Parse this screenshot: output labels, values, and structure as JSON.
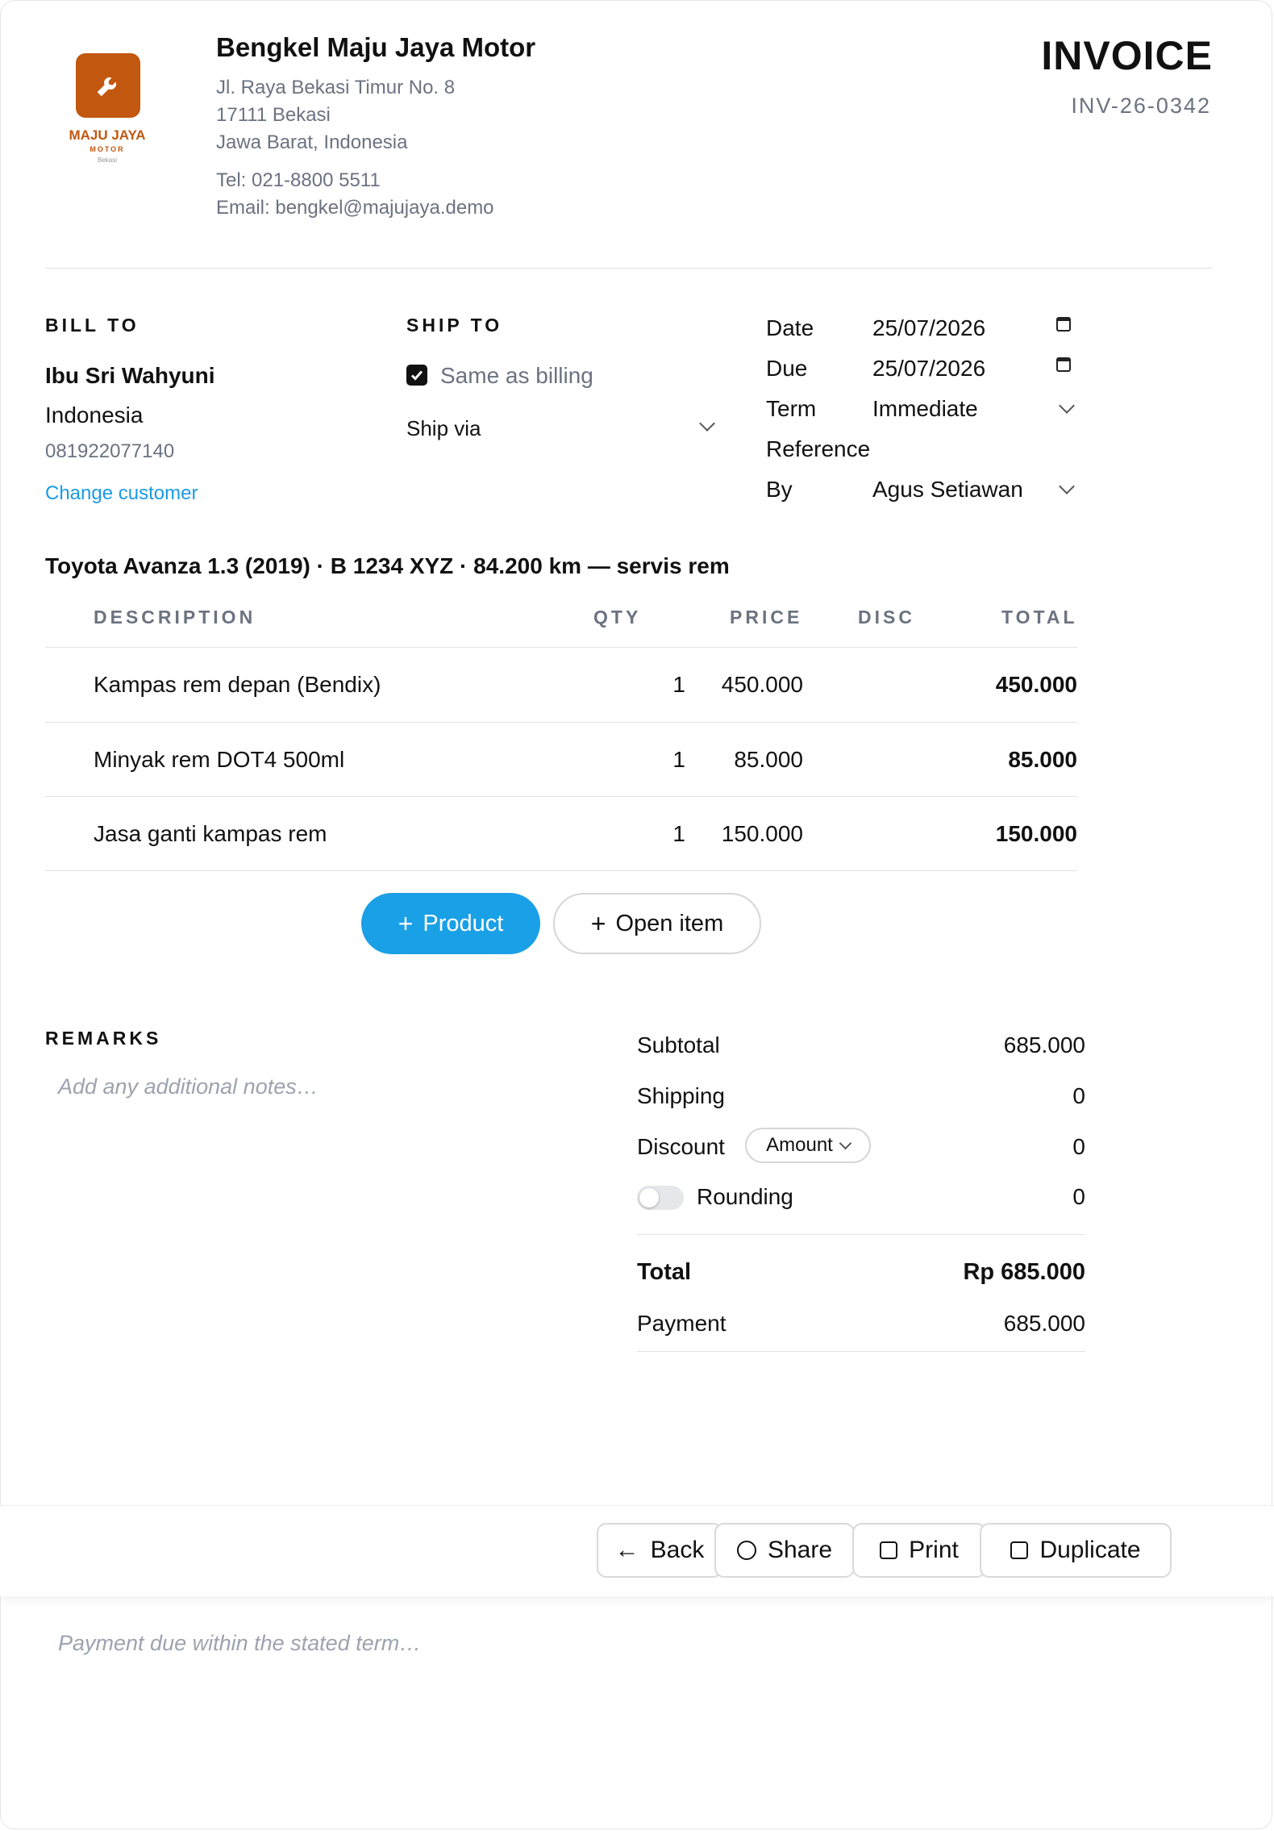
{
  "company": {
    "logo_name": "MAJU JAYA",
    "logo_sub": "MOTOR",
    "logo_city": "Bekasi",
    "name": "Bengkel Maju Jaya Motor",
    "address1": "Jl. Raya Bekasi Timur No. 8",
    "address2": "17111 Bekasi",
    "address3": "Jawa Barat, Indonesia",
    "tel": "Tel: 021-8800 5511",
    "email": "Email: bengkel@majujaya.demo",
    "brand_color": "#c2570f"
  },
  "invoice": {
    "title": "INVOICE",
    "number": "INV-26-0342"
  },
  "bill_to": {
    "label": "BILL TO",
    "name": "Ibu Sri Wahyuni",
    "country": "Indonesia",
    "phone": "081922077140",
    "change_link": "Change customer"
  },
  "ship_to": {
    "label": "SHIP TO",
    "same_as_billing": "Same as billing",
    "same_checked": true,
    "ship_via": "Ship via"
  },
  "meta": {
    "date_label": "Date",
    "date_value": "25/07/2026",
    "due_label": "Due",
    "due_value": "25/07/2026",
    "term_label": "Term",
    "term_value": "Immediate",
    "reference_label": "Reference",
    "reference_value": "",
    "by_label": "By",
    "by_value": "Agus Setiawan"
  },
  "vehicle_line": "Toyota Avanza 1.3 (2019) · B 1234 XYZ · 84.200 km — servis rem",
  "table": {
    "headers": {
      "description": "DESCRIPTION",
      "qty": "QTY",
      "price": "PRICE",
      "disc": "DISC",
      "total": "TOTAL"
    },
    "rows": [
      {
        "description": "Kampas rem depan (Bendix)",
        "qty": "1",
        "price": "450.000",
        "disc": "",
        "total": "450.000"
      },
      {
        "description": "Minyak rem DOT4 500ml",
        "qty": "1",
        "price": "85.000",
        "disc": "",
        "total": "85.000"
      },
      {
        "description": "Jasa ganti kampas rem",
        "qty": "1",
        "price": "150.000",
        "disc": "",
        "total": "150.000"
      }
    ]
  },
  "actions": {
    "add_product": "Product",
    "add_open_item": "Open item"
  },
  "remarks": {
    "label": "REMARKS",
    "placeholder": "Add any additional notes…"
  },
  "totals": {
    "subtotal_label": "Subtotal",
    "subtotal": "685.000",
    "shipping_label": "Shipping",
    "shipping": "0",
    "discount_label": "Discount",
    "discount_mode": "Amount",
    "discount": "0",
    "rounding_label": "Rounding",
    "rounding": "0",
    "rounding_on": false,
    "total_label": "Total",
    "total": "Rp 685.000",
    "payment_label": "Payment",
    "payment": "685.000"
  },
  "footer": {
    "back": "Back",
    "share": "Share",
    "print": "Print",
    "duplicate": "Duplicate",
    "terms_placeholder": "Payment due within the stated term…"
  },
  "colors": {
    "accent": "#1aa0e6",
    "muted": "#6b7280",
    "border": "#e2e2e2"
  }
}
